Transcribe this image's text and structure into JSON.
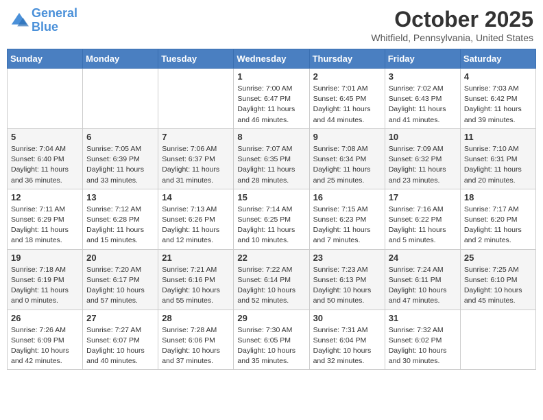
{
  "logo": {
    "line1": "General",
    "line2": "Blue"
  },
  "title": "October 2025",
  "subtitle": "Whitfield, Pennsylvania, United States",
  "days_of_week": [
    "Sunday",
    "Monday",
    "Tuesday",
    "Wednesday",
    "Thursday",
    "Friday",
    "Saturday"
  ],
  "weeks": [
    [
      {
        "day": "",
        "info": ""
      },
      {
        "day": "",
        "info": ""
      },
      {
        "day": "",
        "info": ""
      },
      {
        "day": "1",
        "info": "Sunrise: 7:00 AM\nSunset: 6:47 PM\nDaylight: 11 hours\nand 46 minutes."
      },
      {
        "day": "2",
        "info": "Sunrise: 7:01 AM\nSunset: 6:45 PM\nDaylight: 11 hours\nand 44 minutes."
      },
      {
        "day": "3",
        "info": "Sunrise: 7:02 AM\nSunset: 6:43 PM\nDaylight: 11 hours\nand 41 minutes."
      },
      {
        "day": "4",
        "info": "Sunrise: 7:03 AM\nSunset: 6:42 PM\nDaylight: 11 hours\nand 39 minutes."
      }
    ],
    [
      {
        "day": "5",
        "info": "Sunrise: 7:04 AM\nSunset: 6:40 PM\nDaylight: 11 hours\nand 36 minutes."
      },
      {
        "day": "6",
        "info": "Sunrise: 7:05 AM\nSunset: 6:39 PM\nDaylight: 11 hours\nand 33 minutes."
      },
      {
        "day": "7",
        "info": "Sunrise: 7:06 AM\nSunset: 6:37 PM\nDaylight: 11 hours\nand 31 minutes."
      },
      {
        "day": "8",
        "info": "Sunrise: 7:07 AM\nSunset: 6:35 PM\nDaylight: 11 hours\nand 28 minutes."
      },
      {
        "day": "9",
        "info": "Sunrise: 7:08 AM\nSunset: 6:34 PM\nDaylight: 11 hours\nand 25 minutes."
      },
      {
        "day": "10",
        "info": "Sunrise: 7:09 AM\nSunset: 6:32 PM\nDaylight: 11 hours\nand 23 minutes."
      },
      {
        "day": "11",
        "info": "Sunrise: 7:10 AM\nSunset: 6:31 PM\nDaylight: 11 hours\nand 20 minutes."
      }
    ],
    [
      {
        "day": "12",
        "info": "Sunrise: 7:11 AM\nSunset: 6:29 PM\nDaylight: 11 hours\nand 18 minutes."
      },
      {
        "day": "13",
        "info": "Sunrise: 7:12 AM\nSunset: 6:28 PM\nDaylight: 11 hours\nand 15 minutes."
      },
      {
        "day": "14",
        "info": "Sunrise: 7:13 AM\nSunset: 6:26 PM\nDaylight: 11 hours\nand 12 minutes."
      },
      {
        "day": "15",
        "info": "Sunrise: 7:14 AM\nSunset: 6:25 PM\nDaylight: 11 hours\nand 10 minutes."
      },
      {
        "day": "16",
        "info": "Sunrise: 7:15 AM\nSunset: 6:23 PM\nDaylight: 11 hours\nand 7 minutes."
      },
      {
        "day": "17",
        "info": "Sunrise: 7:16 AM\nSunset: 6:22 PM\nDaylight: 11 hours\nand 5 minutes."
      },
      {
        "day": "18",
        "info": "Sunrise: 7:17 AM\nSunset: 6:20 PM\nDaylight: 11 hours\nand 2 minutes."
      }
    ],
    [
      {
        "day": "19",
        "info": "Sunrise: 7:18 AM\nSunset: 6:19 PM\nDaylight: 11 hours\nand 0 minutes."
      },
      {
        "day": "20",
        "info": "Sunrise: 7:20 AM\nSunset: 6:17 PM\nDaylight: 10 hours\nand 57 minutes."
      },
      {
        "day": "21",
        "info": "Sunrise: 7:21 AM\nSunset: 6:16 PM\nDaylight: 10 hours\nand 55 minutes."
      },
      {
        "day": "22",
        "info": "Sunrise: 7:22 AM\nSunset: 6:14 PM\nDaylight: 10 hours\nand 52 minutes."
      },
      {
        "day": "23",
        "info": "Sunrise: 7:23 AM\nSunset: 6:13 PM\nDaylight: 10 hours\nand 50 minutes."
      },
      {
        "day": "24",
        "info": "Sunrise: 7:24 AM\nSunset: 6:11 PM\nDaylight: 10 hours\nand 47 minutes."
      },
      {
        "day": "25",
        "info": "Sunrise: 7:25 AM\nSunset: 6:10 PM\nDaylight: 10 hours\nand 45 minutes."
      }
    ],
    [
      {
        "day": "26",
        "info": "Sunrise: 7:26 AM\nSunset: 6:09 PM\nDaylight: 10 hours\nand 42 minutes."
      },
      {
        "day": "27",
        "info": "Sunrise: 7:27 AM\nSunset: 6:07 PM\nDaylight: 10 hours\nand 40 minutes."
      },
      {
        "day": "28",
        "info": "Sunrise: 7:28 AM\nSunset: 6:06 PM\nDaylight: 10 hours\nand 37 minutes."
      },
      {
        "day": "29",
        "info": "Sunrise: 7:30 AM\nSunset: 6:05 PM\nDaylight: 10 hours\nand 35 minutes."
      },
      {
        "day": "30",
        "info": "Sunrise: 7:31 AM\nSunset: 6:04 PM\nDaylight: 10 hours\nand 32 minutes."
      },
      {
        "day": "31",
        "info": "Sunrise: 7:32 AM\nSunset: 6:02 PM\nDaylight: 10 hours\nand 30 minutes."
      },
      {
        "day": "",
        "info": ""
      }
    ]
  ]
}
